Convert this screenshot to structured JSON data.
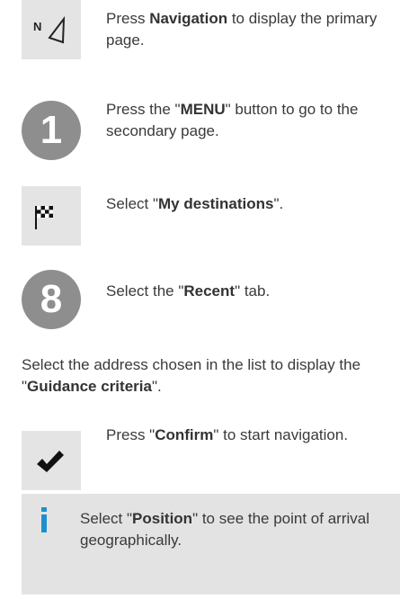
{
  "steps": [
    {
      "icon": "navigation-arrow-icon",
      "glyph": "N",
      "pre": "Press ",
      "bold": "Navigation",
      "post": " to display the primary page."
    },
    {
      "icon": "step-number-1",
      "number": "1",
      "pre": "Press the \"",
      "bold": "MENU",
      "post": "\" button to go to the secondary page."
    },
    {
      "icon": "checkered-flag-icon",
      "pre": "Select \"",
      "bold": "My destinations",
      "post": "\"."
    },
    {
      "icon": "step-number-8",
      "number": "8",
      "pre": "Select the \"",
      "bold": "Recent",
      "post": "\" tab."
    }
  ],
  "paragraph": {
    "pre": "Select the address chosen in the list to display the \"",
    "bold": "Guidance criteria",
    "post": "\"."
  },
  "confirm_step": {
    "icon": "checkmark-icon",
    "pre": "Press \"",
    "bold": "Confirm",
    "post": "\" to start navigation."
  },
  "info": {
    "icon": "info-icon",
    "pre": "Select \"",
    "bold": "Position",
    "post": "\" to see the point of arrival geographically."
  },
  "colors": {
    "circle": "#8e8e8e",
    "icon_bg": "#e4e4e4",
    "info_bg": "#e3e3e3",
    "info_accent": "#1d8fd1"
  }
}
